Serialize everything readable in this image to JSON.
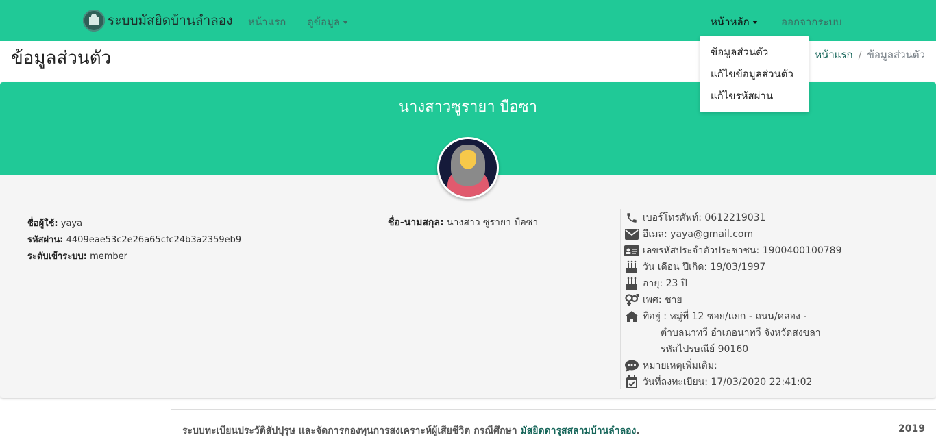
{
  "navbar": {
    "brand": "ระบบมัสยิดบ้านลำลอง",
    "home": "หน้าแรก",
    "view_data": "ดูข้อมูล",
    "main_menu": "หน้าหลัก",
    "logout": "ออกจากระบบ",
    "bg_color": "#20c997"
  },
  "dropdown": {
    "items": [
      "ข้อมูลส่วนตัว",
      "แก้ไขข้อมูลส่วนตัว",
      "แก้ไขรหัสผ่าน"
    ]
  },
  "page": {
    "title": "ข้อมูลส่วนตัว",
    "breadcrumb": [
      "หน้าแรก",
      "ข้อมูลส่วนตัว"
    ]
  },
  "profile": {
    "full_name": "นางสาวซูรายา บือซา",
    "account": {
      "username_label": "ชื่อผู้ใช้:",
      "username": "yaya",
      "password_label": "รหัสผ่าน:",
      "password": "4409eae53c2e26a65cfc24b3a2359eb9",
      "level_label": "ระดับเข้าระบบ:",
      "level": "member"
    },
    "name_label": "ชื่อ-นามสกุล:",
    "name_value": "นางสาว ซูรายา บือซา",
    "details": {
      "phone": "เบอร์โทรศัพท์: 0612219031",
      "email": "อีเมล: yaya@gmail.com",
      "id_card": "เลขรหัสประจำตัวประชาชน: 1900400100789",
      "birthday": "วัน เดือน ปีเกิด: 19/03/1997",
      "age": "อายุ: 23 ปี",
      "gender": "เพศ: ชาย",
      "address_1": "ที่อยู่ : หมู่ที่ 12 ซอย/แยก - ถนน/คลอง -",
      "address_2": "ตำบลนาทวี อำเภอนาทวี จังหวัดสงขลา",
      "address_3": "รหัสไปรษณีย์ 90160",
      "note": "หมายเหตุเพิ่มเติม:",
      "registered": "วันที่ลงทะเบียน: 17/03/2020 22:41:02"
    },
    "icons": [
      "phone-icon",
      "envelope-icon",
      "id-card-icon",
      "birthday-cake-icon",
      "birthday-cake-icon",
      "venus-mars-icon",
      "home-icon",
      "comment-dots-icon",
      "calendar-check-icon"
    ]
  },
  "footer": {
    "text": "ระบบทะเบียนประวัติสัปปุรุษ และจัดการกองทุนการสงเคราะห์ผู้เสียชีวิต กรณีศึกษา",
    "link": "มัสยิดดารุสสลามบ้านลำลอง",
    "suffix": ".",
    "year": "2019"
  }
}
